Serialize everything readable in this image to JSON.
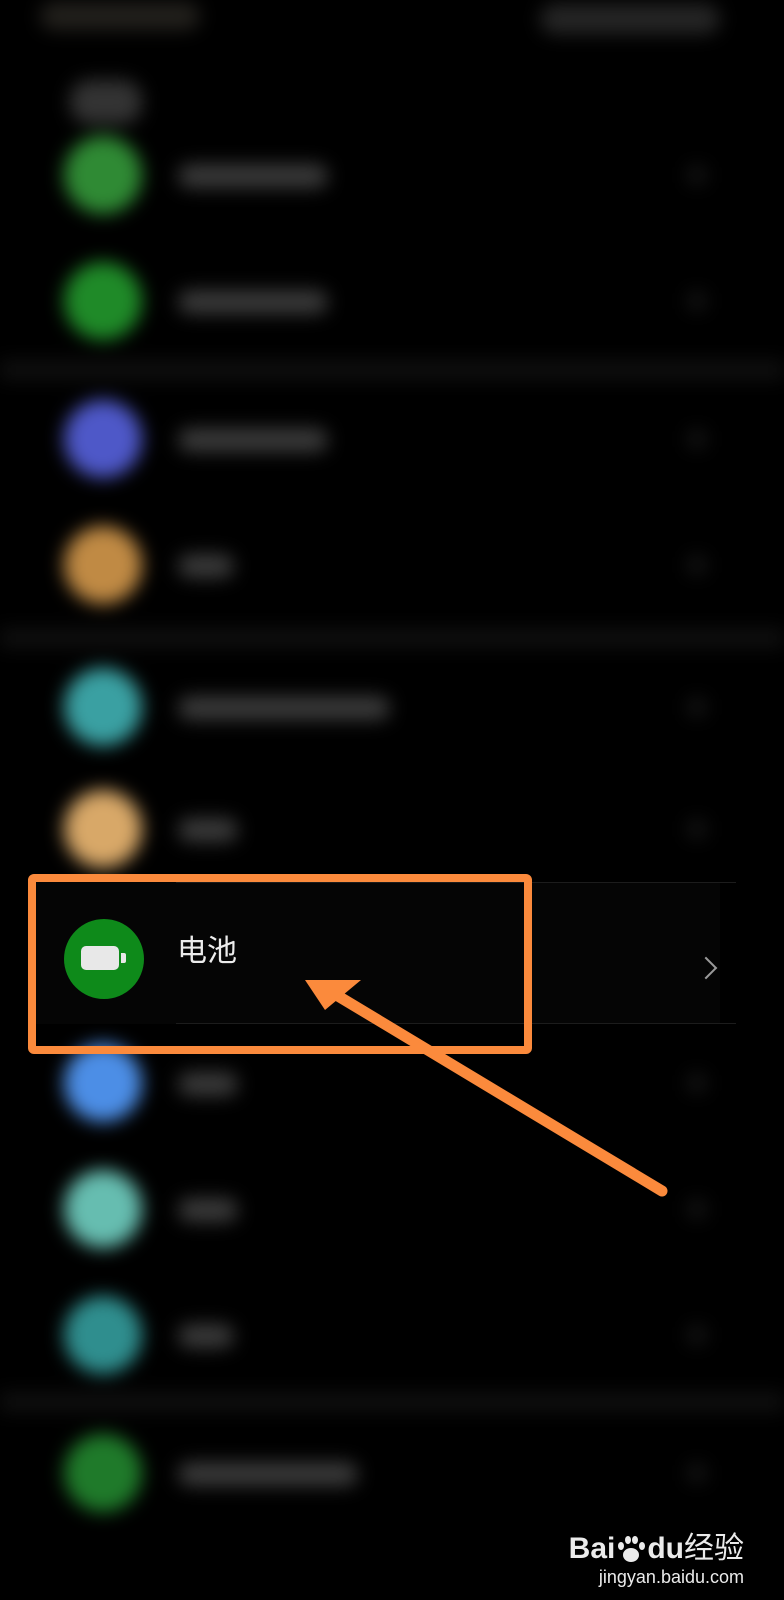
{
  "colors": {
    "background": "#000000",
    "accent_annotation": "#fb8a3c",
    "battery_icon_bg": "#0e8a1a"
  },
  "settings_list": {
    "blurred_icon_colors": [
      "#2f8a34",
      "#1f8a28",
      "#4e58c8",
      "#c08a44",
      "#3aa0a2",
      "#d8a868",
      "#4c8ee6",
      "#66bdb0",
      "#2f8e8e",
      "#1f7a2a"
    ],
    "battery_item": {
      "label": "电池",
      "icon": "battery-icon",
      "chevron": "chevron-right-icon"
    }
  },
  "watermark": {
    "logo_part1": "Bai",
    "logo_part2": "du",
    "logo_part3": "经验",
    "url": "jingyan.baidu.com"
  }
}
